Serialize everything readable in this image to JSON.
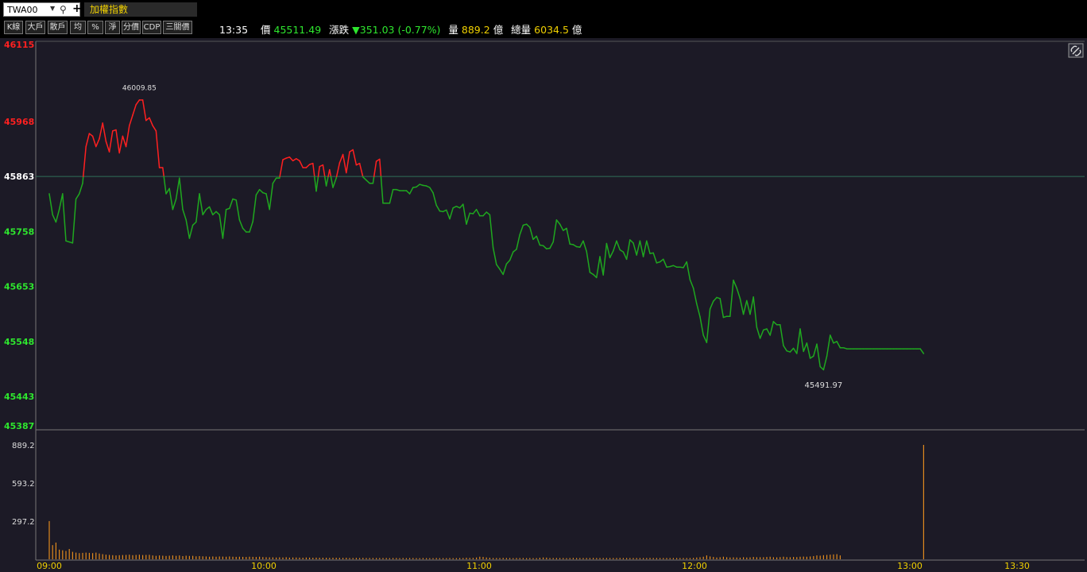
{
  "symbol": {
    "code": "TWA00",
    "name": "加權指數"
  },
  "toolbar": {
    "buttons": [
      "K線",
      "大戶",
      "散戶",
      "均",
      "%",
      "淨",
      "分價",
      "CDP",
      "三關價"
    ]
  },
  "quote": {
    "time": "13:35",
    "price_label": "價",
    "price": "45511.49",
    "change_label": "漲跌",
    "change": "▼351.03 (-0.77%)",
    "vol_label": "量",
    "vol": "889.2",
    "vol_unit": "億",
    "total_label": "總量",
    "total": "6034.5",
    "total_unit": "億"
  },
  "colors": {
    "up": "#ff2020",
    "down": "#1fa81f",
    "ref_line": "#2f6f5a",
    "volume": "#e08a1e",
    "high_label": "#e0208f",
    "low_label": "#7cf07c"
  },
  "chart_data": {
    "type": "line",
    "reference": 45863,
    "ylim": [
      45387,
      46115
    ],
    "y_ticks": [
      "46115",
      "45968",
      "45863",
      "45758",
      "45653",
      "45548",
      "45443",
      "45387"
    ],
    "x_ticks": [
      "09:00",
      "10:00",
      "11:00",
      "12:00",
      "13:00",
      "13:30"
    ],
    "high_label": "46009.85",
    "low_label": "45491.97",
    "series": [
      {
        "name": "",
        "values": [
          45830,
          45790,
          45776,
          45800,
          45830,
          45740,
          45738,
          45736,
          45820,
          45830,
          45850,
          45920,
          45945,
          45940,
          45920,
          45935,
          45965,
          45930,
          45910,
          45950,
          45952,
          45908,
          45940,
          45920,
          45960,
          45980,
          46000,
          46009,
          46009,
          45970,
          45975,
          45960,
          45950,
          45880,
          45880,
          45830,
          45840,
          45800,
          45820,
          45860,
          45800,
          45780,
          45745,
          45770,
          45776,
          45830,
          45790,
          45800,
          45805,
          45790,
          45796,
          45790,
          45745,
          45800,
          45802,
          45820,
          45818,
          45780,
          45764,
          45757,
          45757,
          45777,
          45828,
          45838,
          45832,
          45830,
          45800,
          45850,
          45860,
          45860,
          45895,
          45898,
          45900,
          45893,
          45897,
          45893,
          45880,
          45880,
          45886,
          45888,
          45835,
          45882,
          45885,
          45845,
          45876,
          45842,
          45860,
          45889,
          45905,
          45870,
          45910,
          45914,
          45885,
          45888,
          45862,
          45856,
          45850,
          45850,
          45892,
          45896,
          45812,
          45812,
          45812,
          45838,
          45838,
          45836,
          45836,
          45836,
          45830,
          45842,
          45843,
          45848,
          45846,
          45845,
          45842,
          45832,
          45808,
          45797,
          45796,
          45799,
          45782,
          45803,
          45806,
          45803,
          45810,
          45772,
          45793,
          45792,
          45800,
          45788,
          45788,
          45795,
          45790,
          45727,
          45695,
          45686,
          45676,
          45696,
          45703,
          45719,
          45724,
          45752,
          45770,
          45772,
          45766,
          45743,
          45749,
          45732,
          45731,
          45725,
          45726,
          45738,
          45780,
          45772,
          45760,
          45764,
          45734,
          45733,
          45729,
          45728,
          45740,
          45720,
          45680,
          45676,
          45670,
          45710,
          45675,
          45735,
          45708,
          45721,
          45740,
          45723,
          45719,
          45705,
          45742,
          45736,
          45713,
          45740,
          45710,
          45740,
          45716,
          45717,
          45698,
          45700,
          45705,
          45690,
          45691,
          45693,
          45690,
          45690,
          45689,
          45700,
          45666,
          45650,
          45620,
          45595,
          45560,
          45546,
          45610,
          45625,
          45632,
          45630,
          45594,
          45596,
          45596,
          45665,
          45650,
          45630,
          45600,
          45626,
          45600,
          45633,
          45575,
          45554,
          45570,
          45572,
          45560,
          45586,
          45580,
          45580,
          45540,
          45530,
          45528,
          45535,
          45525,
          45572,
          45529,
          45545,
          45516,
          45520,
          45543,
          45500,
          45494,
          45520,
          45560,
          45545,
          45548,
          45536,
          45536,
          45534,
          45534,
          45534,
          45534,
          45534,
          45534,
          45534,
          45534,
          45534,
          45534,
          45534,
          45534,
          45534,
          45534,
          45534,
          45534,
          45534,
          45534,
          45534,
          45534,
          45534,
          45534,
          45534,
          45525
        ]
      }
    ],
    "volume": {
      "ticks": [
        "889.2",
        "593.2",
        "297.2"
      ],
      "max": 889.2,
      "values": [
        297,
        110,
        130,
        75,
        70,
        65,
        80,
        58,
        52,
        48,
        50,
        52,
        50,
        48,
        52,
        45,
        40,
        36,
        34,
        32,
        30,
        32,
        33,
        34,
        36,
        32,
        34,
        36,
        33,
        34,
        35,
        30,
        27,
        30,
        28,
        26,
        28,
        30,
        27,
        30,
        25,
        28,
        26,
        27,
        23,
        25,
        23,
        22,
        20,
        22,
        20,
        22,
        21,
        20,
        22,
        20,
        19,
        20,
        19,
        18,
        20,
        19,
        18,
        20,
        17,
        16,
        15,
        15,
        14,
        15,
        14,
        16,
        13,
        14,
        14,
        13,
        12,
        14,
        13,
        12,
        13,
        12,
        12,
        12,
        11,
        12,
        12,
        11,
        11,
        12,
        10,
        10,
        11,
        10,
        11,
        10,
        10,
        10,
        10,
        10,
        10,
        10,
        9,
        10,
        10,
        9,
        10,
        9,
        10,
        10,
        9,
        9,
        10,
        9,
        9,
        9,
        10,
        9,
        9,
        9,
        10,
        9,
        9,
        10,
        10,
        12,
        11,
        11,
        14,
        20,
        18,
        14,
        12,
        10,
        10,
        10,
        11,
        10,
        10,
        9,
        10,
        10,
        10,
        9,
        10,
        9,
        9,
        12,
        14,
        13,
        10,
        10,
        10,
        10,
        10,
        9,
        10,
        11,
        10,
        10,
        10,
        10,
        10,
        11,
        10,
        10,
        10,
        10,
        10,
        10,
        10,
        11,
        10,
        10,
        10,
        10,
        10,
        10,
        10,
        10,
        11,
        10,
        10,
        10,
        10,
        10,
        10,
        10,
        10,
        10,
        10,
        10,
        10,
        11,
        14,
        16,
        20,
        30,
        22,
        18,
        14,
        16,
        20,
        16,
        14,
        15,
        14,
        13,
        16,
        14,
        15,
        18,
        16,
        16,
        16,
        18,
        20,
        16,
        15,
        17,
        20,
        17,
        16,
        18,
        17,
        20,
        21,
        20,
        22,
        25,
        30,
        28,
        32,
        34,
        36,
        38,
        40,
        30,
        0,
        0,
        0,
        0,
        0,
        0,
        0,
        0,
        0,
        0,
        0,
        0,
        0,
        0,
        0,
        0,
        0,
        0,
        0,
        0,
        0,
        0,
        0,
        0,
        889.2
      ]
    }
  }
}
